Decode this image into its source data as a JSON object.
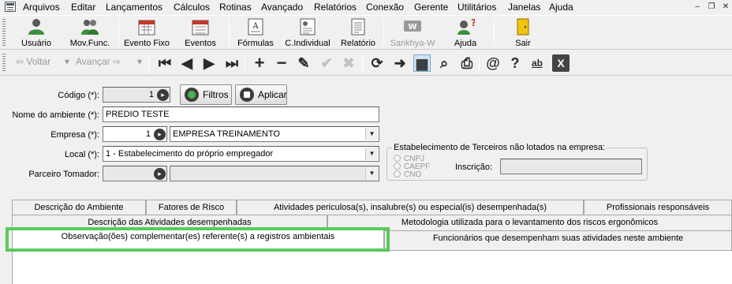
{
  "menu": [
    "Arquivos",
    "Editar",
    "Lançamentos",
    "Cálculos",
    "Rotinas",
    "Avançado",
    "Relatórios",
    "Conexão",
    "Gerente",
    "Utilitários",
    "Janelas",
    "Ajuda"
  ],
  "window_controls": {
    "minimize": "–",
    "restore": "❐",
    "close": "✕"
  },
  "toolbar": {
    "usuario": "Usuário",
    "movfunc": "Mov.Func.",
    "evento_fixo": "Evento Fixo",
    "eventos": "Eventos",
    "formulas": "Fórmulas",
    "cindividual": "C.Individual",
    "relatorio": "Relatório",
    "sankhya": "Sankhya-W",
    "ajuda": "Ajuda",
    "sair": "Sair"
  },
  "nav": {
    "voltar": "Voltar",
    "avancar": "Avançar"
  },
  "icons": {
    "first": "⏮",
    "prev": "◀",
    "next": "▶",
    "last": "⏭",
    "add": "+",
    "remove": "−",
    "edit": "✎",
    "confirm": "✔",
    "cancel": "✖",
    "refresh": "⟳",
    "go": "➜",
    "grid": "▦",
    "search": "⌕",
    "print": "⎙",
    "email": "@",
    "help": "?",
    "spell": "ab",
    "excel": "X"
  },
  "form": {
    "codigo_label": "Código (*):",
    "codigo_value": "1",
    "filtros_label": "Filtros",
    "aplicar_label": "Aplicar",
    "nome_label": "Nome do ambiente (*):",
    "nome_value": "PREDIO TESTE",
    "empresa_label": "Empresa (*):",
    "empresa_code": "1",
    "empresa_name": "EMPRESA TREINAMENTO",
    "local_label": "Local (*):",
    "local_value": "1 - Estabelecimento do próprio empregador",
    "parceiro_label": "Parceiro Tomador:",
    "parceiro_code": "",
    "parceiro_name": ""
  },
  "terceiros": {
    "title": "Estabelecimento de Terceiros não lotados na empresa:",
    "options": [
      "CNPJ",
      "CAEPF",
      "CNO"
    ],
    "inscricao_label": "Inscrição:",
    "inscricao_value": ""
  },
  "tabs_row1": [
    "Descrição do Ambiente",
    "Fatores de Risco",
    "Atividades periculosa(s), insalubre(s) ou especial(is) desempenhada(s)",
    "Profissionais responsáveis"
  ],
  "tabs_row2": [
    "Descrição das Atividades desempenhadas",
    "Metodologia utilizada para o levantamento dos riscos ergonômicos"
  ],
  "tabs_row3": [
    "Observação(ões) complementar(es) referente(s) a registros ambientais",
    "Funcionários que desempenham suas atividades neste ambiente"
  ],
  "highlight_color": "#5cc95c"
}
